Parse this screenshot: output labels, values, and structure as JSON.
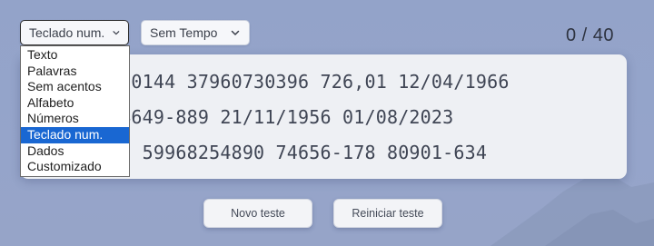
{
  "toolbar": {
    "mode_select": "Teclado num.",
    "time_select": "Sem Tempo"
  },
  "counter": "0 / 40",
  "mode_options": [
    "Texto",
    "Palavras",
    "Sem acentos",
    "Alfabeto",
    "Números",
    "Teclado num.",
    "Dados",
    "Customizado"
  ],
  "selected_option_index": 5,
  "text_lines": [
    "98 21994390144 37960730396 726,01 12/04/1966",
    "08/1990 44649-889 21/11/1956 01/08/2023",
    "020 454,81 59968254890 74656-178 80901-634"
  ],
  "buttons": {
    "new_test": "Novo teste",
    "restart_test": "Reiniciar teste"
  },
  "colors": {
    "background": "#93a3c9",
    "selection": "#1967d2",
    "text": "#3f4554"
  }
}
